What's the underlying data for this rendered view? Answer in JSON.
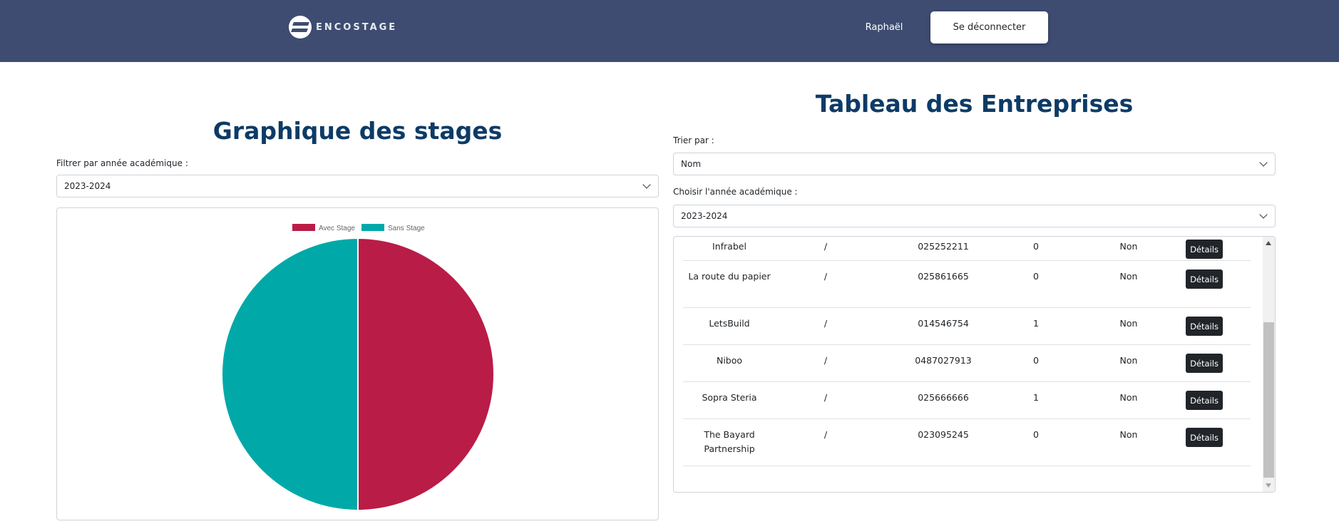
{
  "navbar": {
    "logo_text": "ENCOSTAGE",
    "user_name": "Raphaël",
    "logout_label": "Se déconnecter",
    "bg_color": "#3e4c72"
  },
  "left": {
    "title": "Graphique des stages",
    "filter_label": "Filtrer par année académique :",
    "filter_value": "2023-2024"
  },
  "right": {
    "title": "Tableau des Entreprises",
    "sort_label": "Trier par :",
    "sort_value": "Nom",
    "year_label": "Choisir l'année académique :",
    "year_value": "2023-2024",
    "details_label": "Détails",
    "rows": [
      {
        "name": "Infrabel",
        "slash": "/",
        "tel": "025252211",
        "count": "0",
        "blacklisted": "Non"
      },
      {
        "name": "La route du papier",
        "slash": "/",
        "tel": "025861665",
        "count": "0",
        "blacklisted": "Non"
      },
      {
        "name": "LetsBuild",
        "slash": "/",
        "tel": "014546754",
        "count": "1",
        "blacklisted": "Non"
      },
      {
        "name": "Niboo",
        "slash": "/",
        "tel": "0487027913",
        "count": "0",
        "blacklisted": "Non"
      },
      {
        "name": "Sopra Steria",
        "slash": "/",
        "tel": "025666666",
        "count": "1",
        "blacklisted": "Non"
      },
      {
        "name": "The Bayard Partnership",
        "slash": "/",
        "tel": "023095245",
        "count": "0",
        "blacklisted": "Non"
      }
    ]
  },
  "chart_data": {
    "type": "pie",
    "labels": [
      "Avec Stage",
      "Sans Stage"
    ],
    "values": [
      50,
      50
    ],
    "colors": [
      "#b91c47",
      "#00a9a8"
    ],
    "legend": "top"
  }
}
